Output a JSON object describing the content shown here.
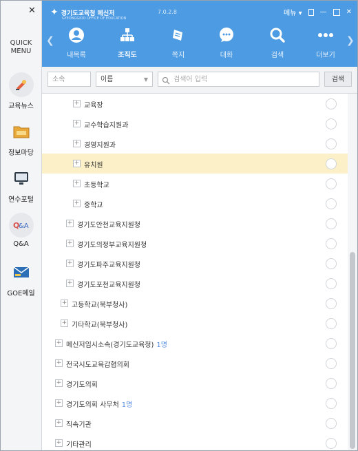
{
  "quick_menu": {
    "close": "✕",
    "title_line1": "QUICK",
    "title_line2": "MENU",
    "items": [
      {
        "label": "교육뉴스",
        "icon": "news-icon"
      },
      {
        "label": "정보마당",
        "icon": "folder-icon"
      },
      {
        "label": "연수포털",
        "icon": "monitor-icon"
      },
      {
        "label": "Q&A",
        "icon": "qa-icon"
      },
      {
        "label": "GOE메일",
        "icon": "mail-icon"
      }
    ]
  },
  "header": {
    "logo_text": "경기도교육청 메신저",
    "logo_sub": "GYEONGGIDO OFFICE OF EDUCATION",
    "version": "7.0.2.8",
    "menu_label": "메뉴",
    "nav": [
      {
        "label": "내목록",
        "icon": "person-icon"
      },
      {
        "label": "조직도",
        "icon": "org-chart-icon",
        "active": true
      },
      {
        "label": "쪽지",
        "icon": "note-icon"
      },
      {
        "label": "대화",
        "icon": "chat-icon"
      },
      {
        "label": "검색",
        "icon": "search-icon"
      },
      {
        "label": "더보기",
        "icon": "more-icon"
      }
    ]
  },
  "search": {
    "scope_placeholder": "소속",
    "field_value": "이름",
    "keyword_placeholder": "검색어 입력",
    "button": "검색"
  },
  "tree": [
    {
      "label": "교육장",
      "expander": "+",
      "level": 3,
      "selected": false,
      "count": ""
    },
    {
      "label": "교수학습지원과",
      "expander": "+",
      "level": 3,
      "selected": false,
      "count": ""
    },
    {
      "label": "경영지원과",
      "expander": "+",
      "level": 3,
      "selected": false,
      "count": ""
    },
    {
      "label": "유치원",
      "expander": "+",
      "level": 3,
      "selected": true,
      "count": ""
    },
    {
      "label": "초등학교",
      "expander": "+",
      "level": 3,
      "selected": false,
      "count": ""
    },
    {
      "label": "중학교",
      "expander": "+",
      "level": 3,
      "selected": false,
      "count": ""
    },
    {
      "label": "경기도안천교육지원청",
      "expander": "+",
      "level": 2,
      "selected": false,
      "count": ""
    },
    {
      "label": "경기도의정부교육지원청",
      "expander": "+",
      "level": 2,
      "selected": false,
      "count": ""
    },
    {
      "label": "경기도파주교육지원청",
      "expander": "+",
      "level": 2,
      "selected": false,
      "count": ""
    },
    {
      "label": "경기도포천교육지원청",
      "expander": "+",
      "level": 2,
      "selected": false,
      "count": ""
    },
    {
      "label": "고등학교(북부청사)",
      "expander": "+",
      "level": 1,
      "selected": false,
      "count": ""
    },
    {
      "label": "기타학교(북부청사)",
      "expander": "+",
      "level": 1,
      "selected": false,
      "count": ""
    },
    {
      "label": "메신저임시소속(경기도교육청)",
      "expander": "+",
      "level": 0,
      "selected": false,
      "count": "1명"
    },
    {
      "label": "전국시도교육감협의회",
      "expander": "+",
      "level": 0,
      "selected": false,
      "count": ""
    },
    {
      "label": "경기도의회",
      "expander": "+",
      "level": 0,
      "selected": false,
      "count": ""
    },
    {
      "label": "경기도의회 사무처",
      "expander": "+",
      "level": 0,
      "selected": false,
      "count": "1명"
    },
    {
      "label": "직속기관",
      "expander": "+",
      "level": 0,
      "selected": false,
      "count": ""
    },
    {
      "label": "기타관리",
      "expander": "+",
      "level": 0,
      "selected": false,
      "count": ""
    }
  ],
  "colors": {
    "header": "#4c9be3",
    "selected_row": "#fbf0c8",
    "count": "#5a8ee0"
  }
}
